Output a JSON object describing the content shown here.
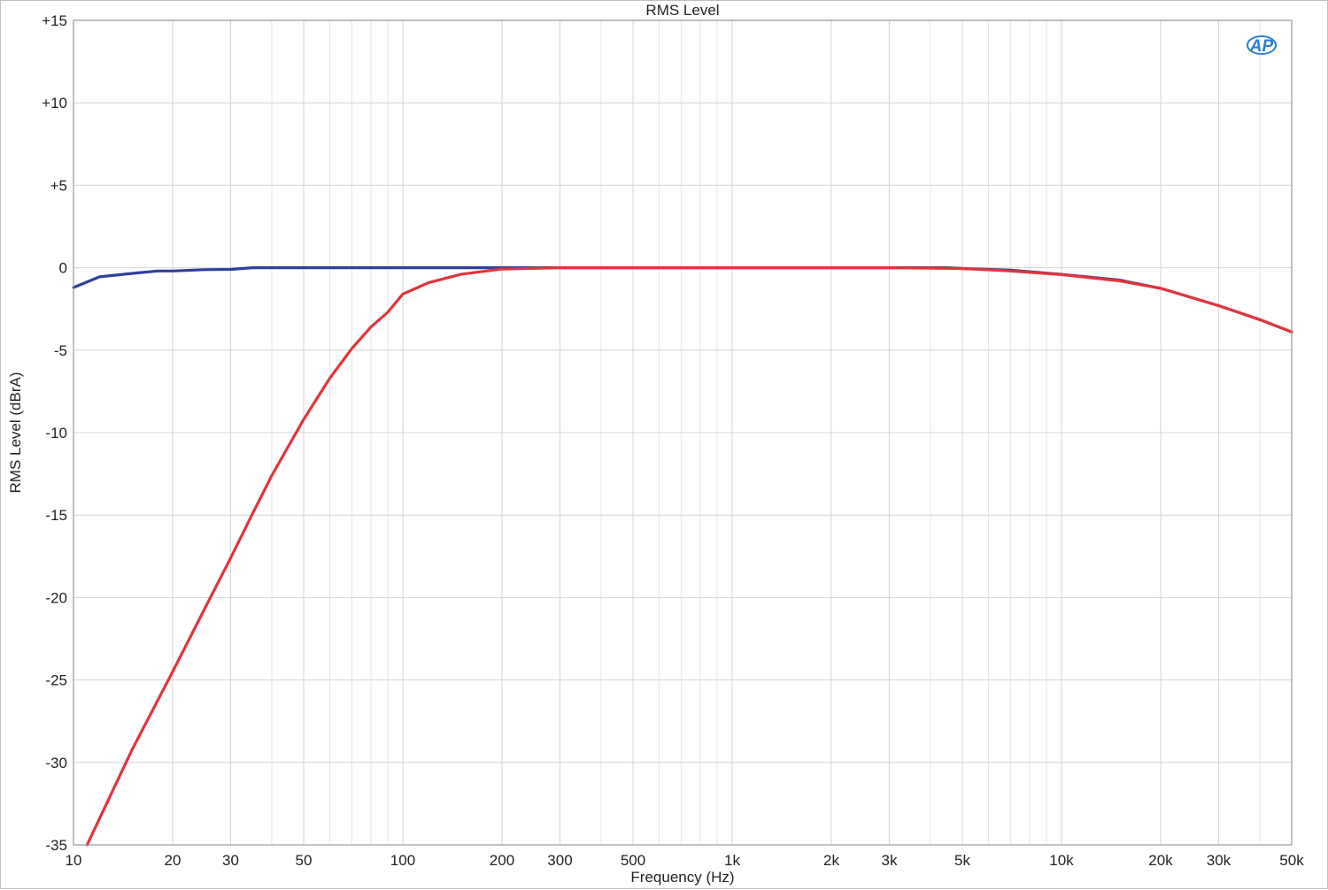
{
  "chart_data": {
    "type": "line",
    "title": "RMS Level",
    "xlabel": "Frequency (Hz)",
    "ylabel": "RMS Level (dBrA)",
    "x_scale": "log",
    "xlim": [
      10,
      50000
    ],
    "ylim": [
      -35,
      15
    ],
    "grid": true,
    "x_ticks": [
      {
        "value": 10,
        "label": "10"
      },
      {
        "value": 20,
        "label": "20"
      },
      {
        "value": 30,
        "label": "30"
      },
      {
        "value": 50,
        "label": "50"
      },
      {
        "value": 100,
        "label": "100"
      },
      {
        "value": 200,
        "label": "200"
      },
      {
        "value": 300,
        "label": "300"
      },
      {
        "value": 500,
        "label": "500"
      },
      {
        "value": 1000,
        "label": "1k"
      },
      {
        "value": 2000,
        "label": "2k"
      },
      {
        "value": 3000,
        "label": "3k"
      },
      {
        "value": 5000,
        "label": "5k"
      },
      {
        "value": 10000,
        "label": "10k"
      },
      {
        "value": 20000,
        "label": "20k"
      },
      {
        "value": 30000,
        "label": "30k"
      },
      {
        "value": 50000,
        "label": "50k"
      }
    ],
    "y_ticks": [
      {
        "value": 15,
        "label": "+15"
      },
      {
        "value": 10,
        "label": "+10"
      },
      {
        "value": 5,
        "label": "+5"
      },
      {
        "value": 0,
        "label": "0"
      },
      {
        "value": -5,
        "label": "-5"
      },
      {
        "value": -10,
        "label": "-10"
      },
      {
        "value": -15,
        "label": "-15"
      },
      {
        "value": -20,
        "label": "-20"
      },
      {
        "value": -25,
        "label": "-25"
      },
      {
        "value": -30,
        "label": "-30"
      },
      {
        "value": -35,
        "label": "-35"
      }
    ],
    "series": [
      {
        "color": "#2e3f9c",
        "x": [
          10,
          12,
          15,
          18,
          20,
          25,
          30,
          35,
          50,
          100,
          200,
          500,
          1000,
          2000,
          3000,
          4500,
          5000,
          7000,
          10000,
          15000,
          20000,
          30000,
          40000,
          50000
        ],
        "y": [
          -1.2,
          -0.55,
          -0.35,
          -0.2,
          -0.2,
          -0.12,
          -0.1,
          0,
          0,
          0,
          0,
          0,
          0,
          0,
          0,
          0,
          -0.05,
          -0.15,
          -0.4,
          -0.75,
          -1.25,
          -2.3,
          -3.15,
          -3.9
        ]
      },
      {
        "color": "#e0353b",
        "x": [
          11,
          15,
          20,
          25,
          30,
          35,
          40,
          50,
          60,
          70,
          80,
          90,
          100,
          120,
          150,
          200,
          300,
          500,
          1000,
          2000,
          3000,
          5000,
          7000,
          10000,
          15000,
          20000,
          30000,
          40000,
          50000
        ],
        "y": [
          -35,
          -29.3,
          -24.5,
          -20.7,
          -17.6,
          -14.9,
          -12.6,
          -9.2,
          -6.7,
          -4.9,
          -3.6,
          -2.7,
          -1.6,
          -0.9,
          -0.4,
          -0.08,
          0,
          0,
          0,
          0,
          0,
          -0.05,
          -0.2,
          -0.42,
          -0.8,
          -1.25,
          -2.3,
          -3.15,
          -3.9
        ]
      }
    ]
  },
  "logo": {
    "text": "AP",
    "color": "#2a7fd0"
  }
}
